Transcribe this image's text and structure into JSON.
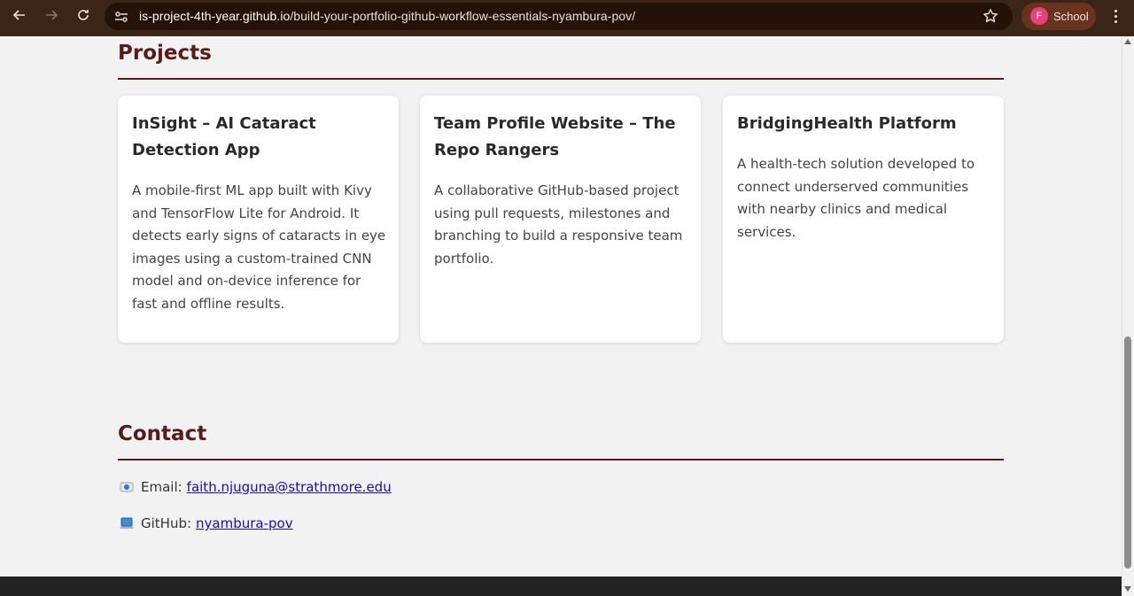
{
  "browser": {
    "url_host": "is-project-4th-year.github.io",
    "url_path": "/build-your-portfolio-github-workflow-essentials-nyambura-pov/",
    "profile_initial": "F",
    "profile_name": "School"
  },
  "projects": {
    "title": "Projects",
    "cards": [
      {
        "title": "InSight – AI Cataract Detection App",
        "description": "A mobile-first ML app built with Kivy and TensorFlow Lite for Android. It detects early signs of cataracts in eye images using a custom-trained CNN model and on-device inference for fast and offline results."
      },
      {
        "title": "Team Profile Website – The Repo Rangers",
        "description": "A collaborative GitHub-based project using pull requests, milestones and branching to build a responsive team portfolio."
      },
      {
        "title": "BridgingHealth Platform",
        "description": "A health-tech solution developed to connect underserved communities with nearby clinics and medical services."
      }
    ]
  },
  "contact": {
    "title": "Contact",
    "email_label": "Email:",
    "email_value": "faith.njuguna@strathmore.edu",
    "github_label": "GitHub:",
    "github_value": "nyambura-pov"
  },
  "colors": {
    "accent": "#5a1a1a",
    "link": "#1a0dab",
    "chrome": "#3b2418"
  }
}
